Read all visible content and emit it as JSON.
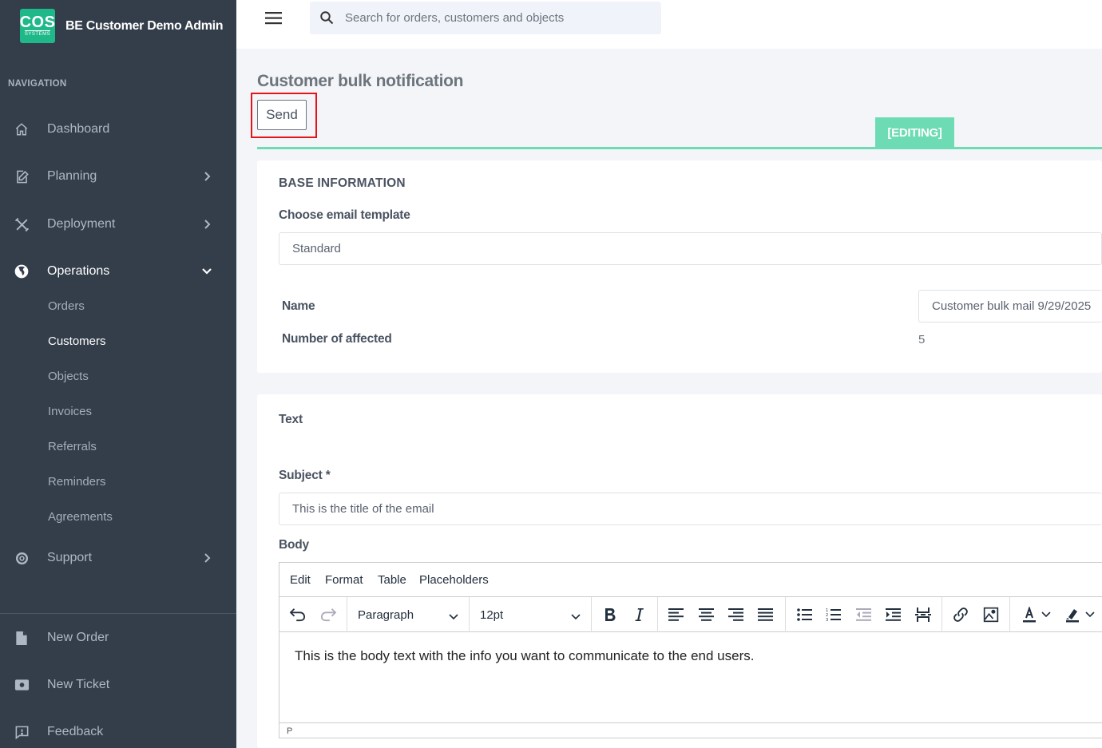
{
  "brand": {
    "logo_top": "COS",
    "logo_bottom": "SYSTEMS",
    "name": "BE Customer Demo Admin"
  },
  "sidebar": {
    "heading": "NAVIGATION",
    "items": [
      {
        "label": "Dashboard",
        "icon": "home-icon"
      },
      {
        "label": "Planning",
        "icon": "edit-icon"
      },
      {
        "label": "Deployment",
        "icon": "tools-icon"
      },
      {
        "label": "Operations",
        "icon": "globe-icon"
      }
    ],
    "subitems": [
      "Orders",
      "Customers",
      "Objects",
      "Invoices",
      "Referrals",
      "Reminders",
      "Agreements"
    ],
    "support": "Support",
    "bottom": [
      "New Order",
      "New Ticket",
      "Feedback"
    ]
  },
  "search": {
    "placeholder": "Search for orders, customers and objects"
  },
  "page": {
    "title": "Customer bulk notification",
    "send_label": "Send",
    "status_tag": "[EDITING]"
  },
  "base": {
    "heading": "BASE INFORMATION",
    "template_label": "Choose email template",
    "template_value": "Standard",
    "name_label": "Name",
    "name_value": "Customer bulk mail 9/29/2025",
    "affected_label": "Number of affected",
    "affected_value": "5"
  },
  "text": {
    "heading": "Text",
    "subject_label": "Subject *",
    "subject_value": "This is the title of the email",
    "body_label": "Body"
  },
  "editor": {
    "menu": [
      "Edit",
      "Format",
      "Table",
      "Placeholders"
    ],
    "block_format": "Paragraph",
    "font_size": "12pt",
    "body_text": "This is the body text with the info you want to communicate to the end users.",
    "status_path": "P"
  },
  "colors": {
    "sidebar": "#343e4a",
    "accent": "#6ddbb3",
    "logo": "#1fb889",
    "highlight": "#e3151a"
  }
}
